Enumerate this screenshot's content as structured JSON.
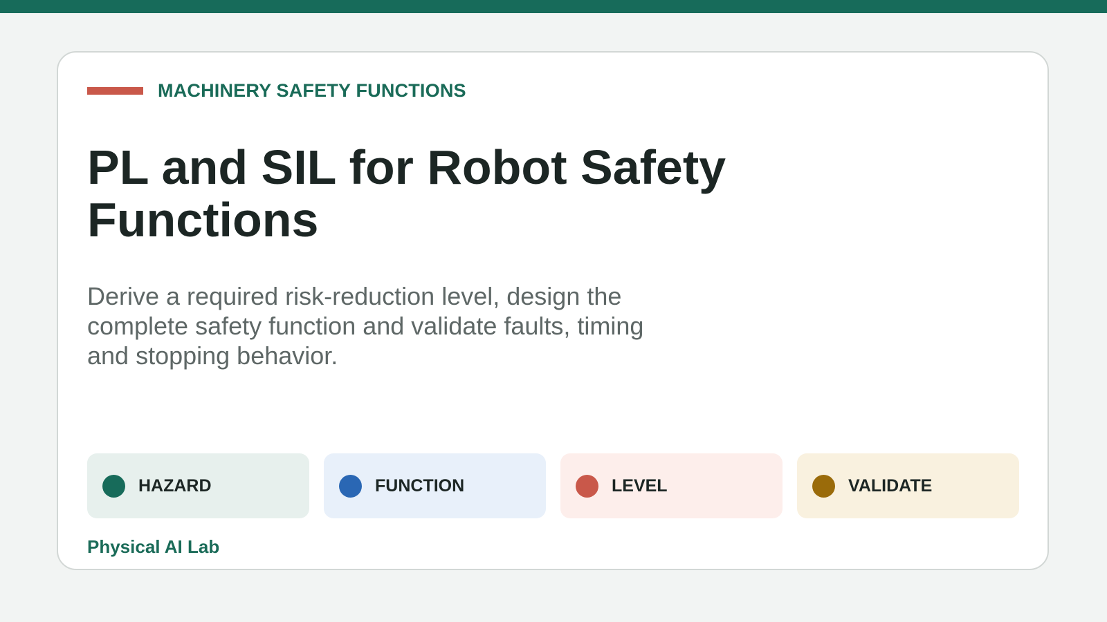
{
  "header": {
    "eyebrow": "MACHINERY SAFETY FUNCTIONS",
    "title": "PL and SIL for Robot Safety Functions",
    "subtitle": "Derive a required risk-reduction level, design the complete safety function and validate faults, timing and stopping behavior."
  },
  "chips": [
    {
      "label": "HAZARD",
      "dot_color": "#176b5a",
      "bg_color": "#e7f0ed"
    },
    {
      "label": "FUNCTION",
      "dot_color": "#2a67b4",
      "bg_color": "#e8f0fa"
    },
    {
      "label": "LEVEL",
      "dot_color": "#c9584a",
      "bg_color": "#fdeeeb"
    },
    {
      "label": "VALIDATE",
      "dot_color": "#9a6b0a",
      "bg_color": "#f9f1df"
    }
  ],
  "footer": {
    "brand": "Physical AI Lab"
  },
  "colors": {
    "accent": "#176b5a",
    "eyebrow_bar": "#c9584a"
  }
}
